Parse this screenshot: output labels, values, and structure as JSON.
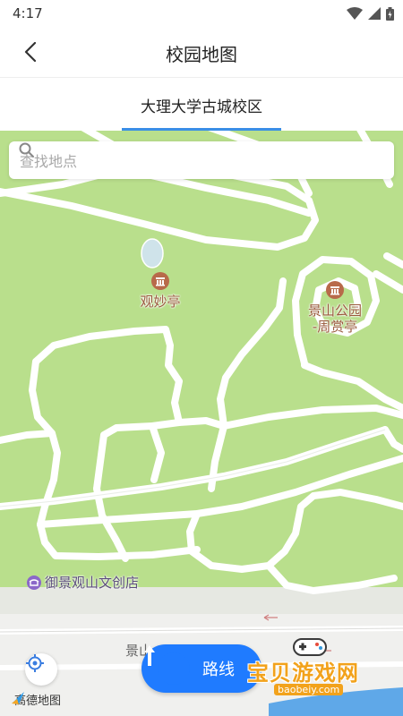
{
  "status_bar": {
    "time": "4:17"
  },
  "header": {
    "title": "校园地图"
  },
  "tabs": [
    {
      "label": "大理大学古城校区",
      "active": true
    }
  ],
  "search": {
    "placeholder": "查找地点"
  },
  "map": {
    "pois": [
      {
        "label": "观妙亭",
        "icon": "landmark-icon"
      },
      {
        "label_line1": "景山公园",
        "label_line2": "-周赏亭",
        "icon": "landmark-icon"
      }
    ],
    "shop": {
      "label": "御景观山文创店",
      "icon": "shop-icon"
    },
    "road_label": "景山",
    "logo_text": "高德地图"
  },
  "route_button": {
    "label": "路线"
  },
  "watermark": {
    "text": "宝贝游戏网",
    "url": "baobeiy.com"
  },
  "colors": {
    "accent": "#3a8ee6",
    "route": "#1f7bff",
    "map_green": "#b9df8c",
    "poi_brown": "#b86a4a",
    "shop_purple": "#8b67c9"
  }
}
